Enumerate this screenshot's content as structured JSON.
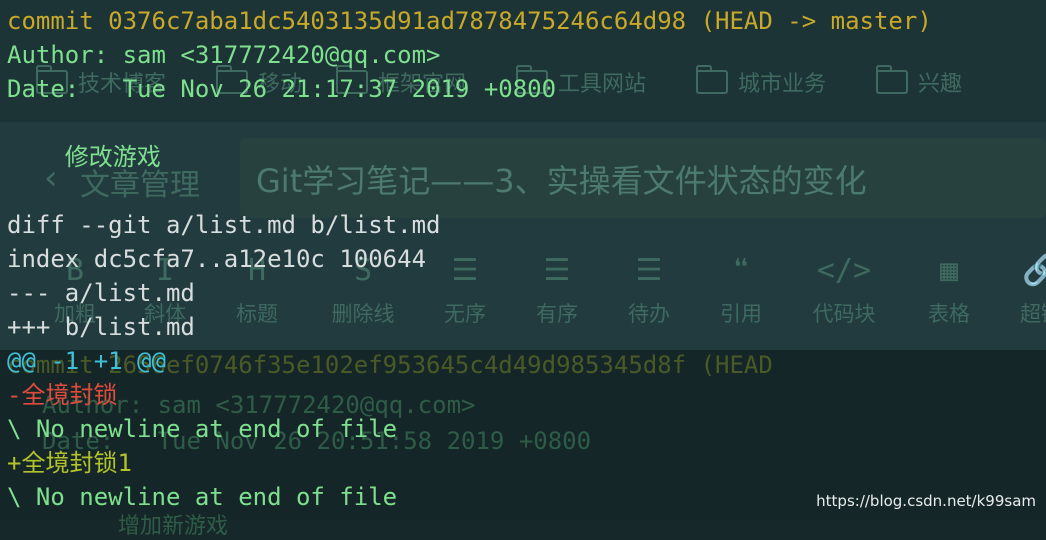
{
  "terminal": {
    "commit_label": "commit 0376c7aba1dc5403135d91ad7878475246c64d98",
    "commit_refs": " (HEAD -> master)",
    "author": "Author: sam <317772420@qq.com>",
    "date": "Date:   Tue Nov 26 21:17:37 2019 +0800",
    "message": "    修改游戏",
    "diff_header": "diff --git a/list.md b/list.md",
    "index": "index dc5cfa7..a12e10c 100644",
    "old_file": "--- a/list.md",
    "new_file": "+++ b/list.md",
    "hunk": "@@ -1 +1 @@",
    "removed": "-全境封锁",
    "no_newline_1": "\\ No newline at end of file",
    "added": "+全境封锁1",
    "no_newline_2": "\\ No newline at end of file"
  },
  "background": {
    "bookmarks": [
      "技术博客",
      "移动",
      "框架官网",
      "工具网站",
      "城市业务",
      "兴趣"
    ],
    "back_label": "文章管理",
    "article_title": "Git学习笔记——3、实操看文件状态的变化",
    "toolbar": [
      {
        "label": "加粗",
        "icon": "B"
      },
      {
        "label": "斜体",
        "icon": "I"
      },
      {
        "label": "标题",
        "icon": "H"
      },
      {
        "label": "删除线",
        "icon": "S"
      },
      {
        "label": "无序",
        "icon": "☰"
      },
      {
        "label": "有序",
        "icon": "☰"
      },
      {
        "label": "待办",
        "icon": "☰"
      },
      {
        "label": "引用",
        "icon": "❝"
      },
      {
        "label": "代码块",
        "icon": "</>"
      },
      {
        "label": "表格",
        "icon": "▦"
      },
      {
        "label": "超链",
        "icon": "🔗"
      }
    ],
    "ghost_commit": "commit 2656ef0746f35e102ef953645c4d49d985345d8f (HEAD",
    "ghost_author": "Author: sam <317772420@qq.com>",
    "ghost_date": "Date:   Tue Nov 26 20:51:58 2019 +0800",
    "ghost_bookmarks": [
      "框架官网",
      "工具网站",
      "城市业务"
    ],
    "ghost_message": "增加新游戏"
  },
  "watermark": "https://blog.csdn.net/k99sam"
}
